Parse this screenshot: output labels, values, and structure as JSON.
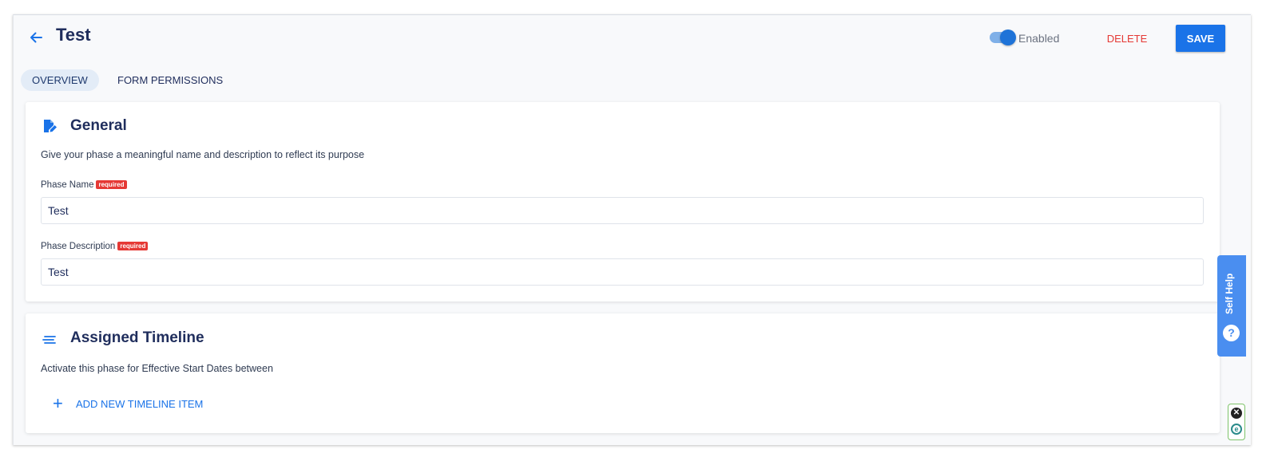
{
  "header": {
    "title": "Test",
    "back_icon": "arrow-left-icon",
    "toggle_label": "Enabled",
    "toggle_on": true,
    "delete_label": "DELETE",
    "save_label": "SAVE"
  },
  "tabs": [
    {
      "label": "OVERVIEW",
      "active": true
    },
    {
      "label": "FORM PERMISSIONS",
      "active": false
    }
  ],
  "general": {
    "icon": "edit-document-icon",
    "title": "General",
    "description": "Give your phase a meaningful name and description to reflect its purpose",
    "fields": [
      {
        "label": "Phase Name",
        "badge": "required",
        "value": "Test"
      },
      {
        "label": "Phase Description",
        "badge": "required",
        "value": "Test"
      }
    ]
  },
  "timeline": {
    "icon": "list-lines-icon",
    "title": "Assigned Timeline",
    "description": "Activate this phase for Effective Start Dates between",
    "add_label": "ADD NEW TIMELINE ITEM"
  },
  "self_help": {
    "label": "Self Help",
    "icon_text": "?"
  },
  "widget": {
    "close_text": "✕",
    "logo_text": "e"
  },
  "colors": {
    "primary": "#1a73e8",
    "danger": "#e53935",
    "heading": "#1f2d5c",
    "self_help_bg": "#4a8ef0"
  }
}
